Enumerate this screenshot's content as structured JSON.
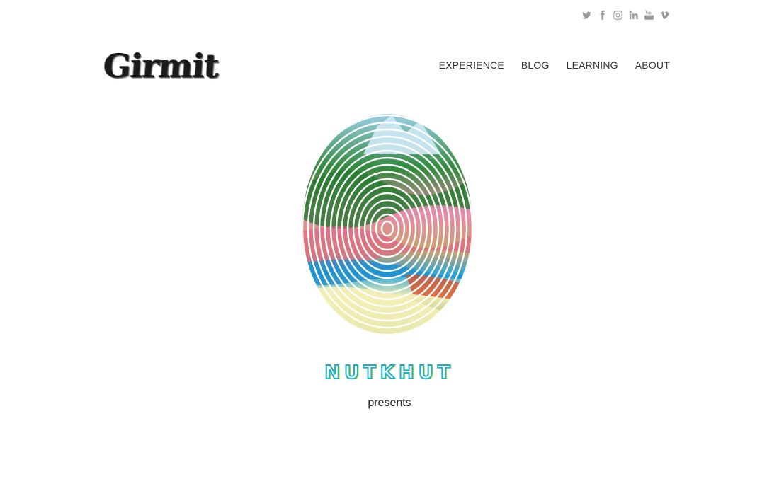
{
  "header": {
    "logo_text": "Girmit",
    "social": [
      {
        "icon": "twitter-icon"
      },
      {
        "icon": "facebook-icon"
      },
      {
        "icon": "instagram-icon"
      },
      {
        "icon": "linkedin-icon"
      },
      {
        "icon": "youtube-icon"
      },
      {
        "icon": "vimeo-icon"
      }
    ],
    "nav": {
      "experience": "EXPERIENCE",
      "blog": "BLOG",
      "learning": "LEARNING",
      "about": "ABOUT"
    }
  },
  "main": {
    "brand_text": "NUTKHUT",
    "tagline": "presents",
    "colors": {
      "brand_outline": "#19b0c8",
      "brand_shadow": "#f4e33a",
      "icon_grey": "#9a9a9a"
    }
  }
}
